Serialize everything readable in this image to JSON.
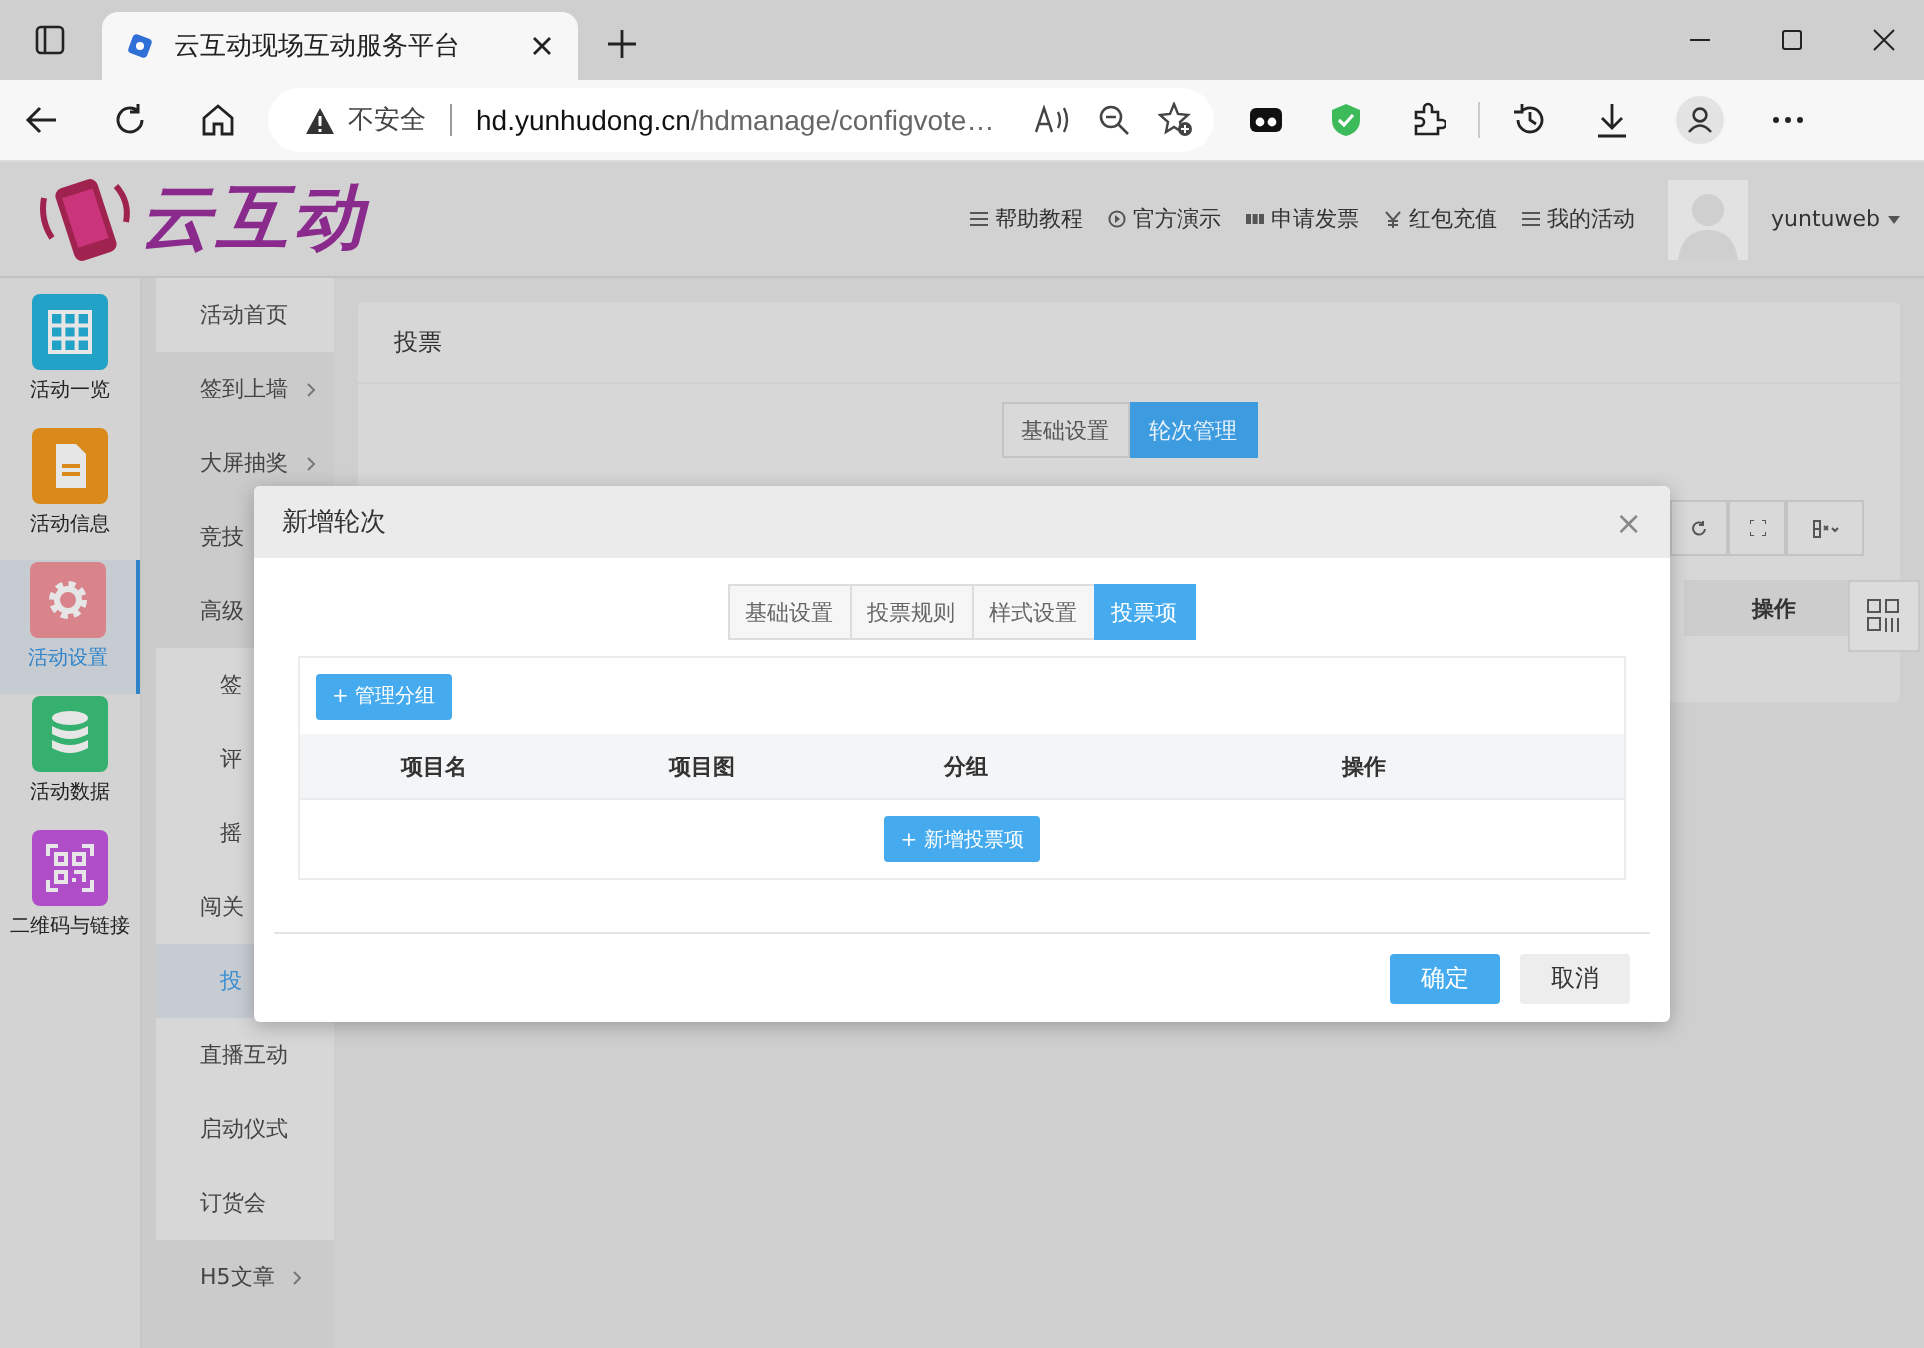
{
  "browser": {
    "tab_title": "云互动现场互动服务平台",
    "security": "不安全",
    "url_host": "hd.yunhudong.cn",
    "url_path": "/hdmanage/configvote…"
  },
  "header": {
    "logo": "云互动",
    "nav": [
      "帮助教程",
      "官方演示",
      "申请发票",
      "红包充值",
      "我的活动"
    ],
    "user": "yuntuweb"
  },
  "sidebar": {
    "items": [
      {
        "label": "活动一览",
        "color": "#22a2c6",
        "selected": false
      },
      {
        "label": "活动信息",
        "color": "#d98a1a",
        "selected": false
      },
      {
        "label": "活动设置",
        "color": "#d9838a",
        "selected": true
      },
      {
        "label": "活动数据",
        "color": "#35b06e",
        "selected": false
      },
      {
        "label": "二维码与链接",
        "color": "#b04ec9",
        "selected": false
      }
    ]
  },
  "submenu": {
    "items": [
      {
        "label": "活动首页",
        "kind": "top",
        "expandable": false,
        "selected": false
      },
      {
        "label": "签到上墙",
        "kind": "group",
        "expandable": true,
        "selected": false
      },
      {
        "label": "大屏抽奖",
        "kind": "group",
        "expandable": true,
        "selected": false
      },
      {
        "label": "竞技",
        "kind": "group",
        "expandable": false,
        "selected": false
      },
      {
        "label": "高级",
        "kind": "group",
        "expandable": false,
        "selected": false
      },
      {
        "label": "签",
        "kind": "sub",
        "expandable": false,
        "selected": false
      },
      {
        "label": "评",
        "kind": "sub",
        "expandable": false,
        "selected": false
      },
      {
        "label": "摇",
        "kind": "sub",
        "expandable": false,
        "selected": false
      },
      {
        "label": "闯关",
        "kind": "plain",
        "expandable": false,
        "selected": false
      },
      {
        "label": "投",
        "kind": "sub",
        "expandable": false,
        "selected": true
      },
      {
        "label": "直播互动",
        "kind": "plain",
        "expandable": false,
        "selected": false
      },
      {
        "label": "启动仪式",
        "kind": "plain",
        "expandable": false,
        "selected": false
      },
      {
        "label": "订货会",
        "kind": "plain",
        "expandable": false,
        "selected": false
      },
      {
        "label": "H5文章",
        "kind": "group",
        "expandable": true,
        "selected": false
      }
    ]
  },
  "panel": {
    "title": "投票",
    "tabs": [
      {
        "label": "基础设置",
        "selected": false
      },
      {
        "label": "轮次管理",
        "selected": true
      }
    ],
    "table_header": "操作"
  },
  "modal": {
    "title": "新增轮次",
    "close": "×",
    "tabs": [
      {
        "label": "基础设置",
        "selected": false
      },
      {
        "label": "投票规则",
        "selected": false
      },
      {
        "label": "样式设置",
        "selected": false
      },
      {
        "label": "投票项",
        "selected": true
      }
    ],
    "manage_button": "+ 管理分组",
    "columns": [
      "项目名",
      "项目图",
      "分组",
      "操作"
    ],
    "add_button": "+ 新增投票项",
    "buttons": [
      {
        "label": "确定",
        "kind": "primary"
      },
      {
        "label": "取消",
        "kind": "default"
      }
    ]
  }
}
